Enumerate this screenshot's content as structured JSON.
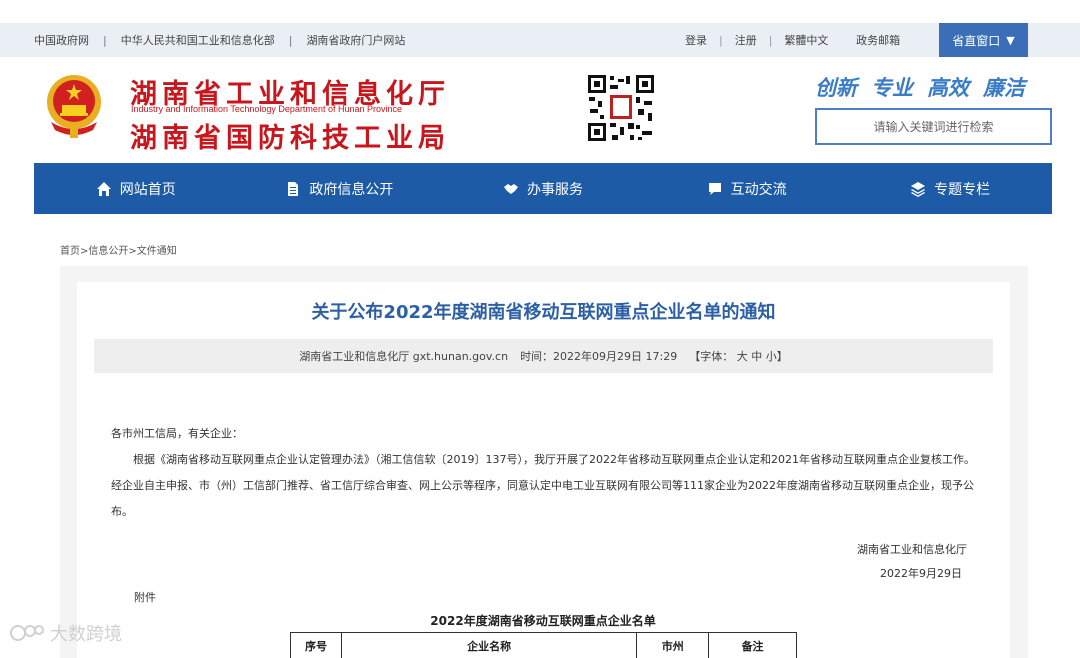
{
  "topbar": {
    "links": [
      "中国政府网",
      "中华人民共和国工业和信息化部",
      "湖南省政府门户网站"
    ],
    "separator": "|",
    "right": [
      "登录",
      "注册",
      "繁體中文",
      "政务邮箱"
    ],
    "portal": "省直窗口",
    "portal_caret": "▼"
  },
  "header": {
    "title_line1": "湖南省工业和信息化厅",
    "title_en": "Industry and Information Technology Department of Hunan Province",
    "title_line2": "湖南省国防科技工业局",
    "slogan": [
      "创新",
      "专业",
      "高效",
      "廉洁"
    ],
    "search_placeholder": "请输入关键词进行检索"
  },
  "nav": [
    {
      "label": "网站首页",
      "icon": "home-icon"
    },
    {
      "label": "政府信息公开",
      "icon": "document-icon"
    },
    {
      "label": "办事服务",
      "icon": "handshake-icon"
    },
    {
      "label": "互动交流",
      "icon": "chat-icon"
    },
    {
      "label": "专题专栏",
      "icon": "layers-icon"
    }
  ],
  "breadcrumb": "首页>信息公开>文件通知",
  "article": {
    "title": "关于公布2022年度湖南省移动互联网重点企业名单的通知",
    "source": "湖南省工业和信息化厅 gxt.hunan.gov.cn",
    "time": "时间：2022年09月29日 17:29",
    "font_size": "【字体：",
    "font_options": [
      "大",
      "中",
      "小"
    ],
    "font_close": "】",
    "salutation": "各市州工信局，有关企业：",
    "paragraph": "根据《湖南省移动互联网重点企业认定管理办法》（湘工信信软〔2019〕137号），我厅开展了2022年省移动互联网重点企业认定和2021年省移动互联网重点企业复核工作。经企业自主申报、市（州）工信部门推荐、省工信厅综合审查、网上公示等程序，同意认定中电工业互联网有限公司等111家企业为2022年度湖南省移动互联网重点企业，现予公布。",
    "signature_org": "湖南省工业和信息化厅",
    "signature_date": "2022年9月29日",
    "attachment": "附件",
    "table_title": "2022年度湖南省移动互联网重点企业名单",
    "table_headers": [
      "序号",
      "企业名称",
      "市州",
      "备注"
    ]
  },
  "watermark": "大数跨境"
}
